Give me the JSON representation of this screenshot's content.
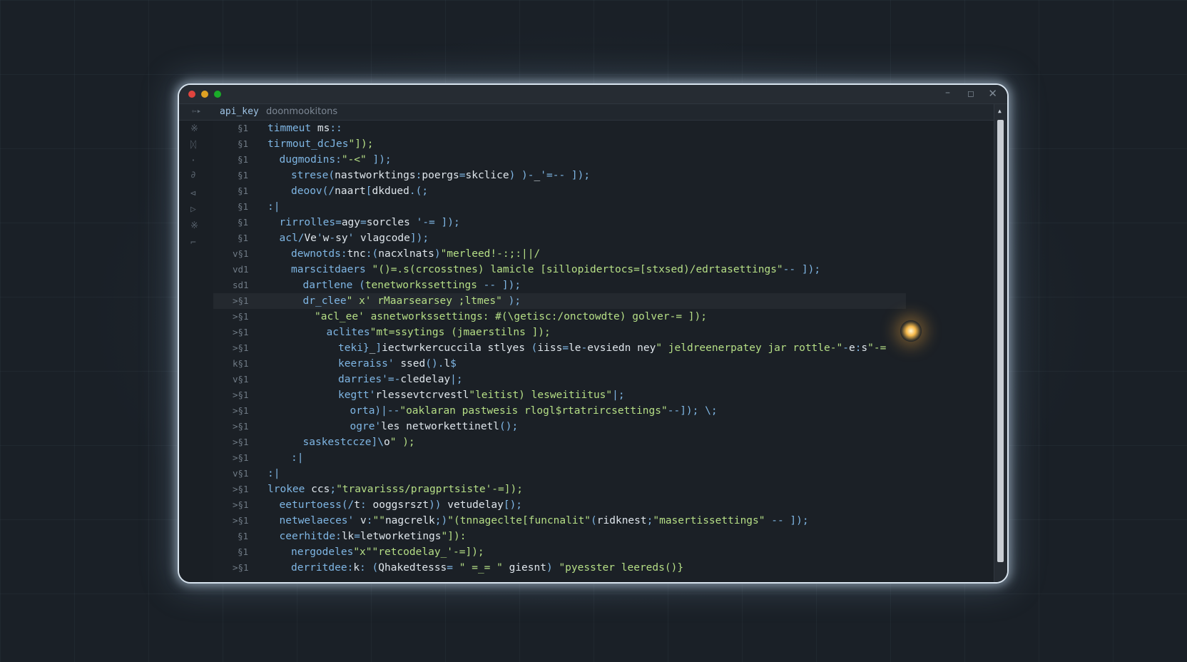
{
  "window": {
    "controls": {
      "minimize": "–",
      "maximize": "◻",
      "close": "✕"
    }
  },
  "tabbar": {
    "nav_glyph": "⇦▸",
    "tabs": [
      {
        "label": "api_key"
      },
      {
        "label": "doonmookitons"
      }
    ]
  },
  "activity_icons": [
    {
      "name": "search-icon",
      "glyph": "※"
    },
    {
      "name": "branch-icon",
      "glyph": "ᛞ"
    },
    {
      "name": "separator-icon",
      "glyph": "·"
    },
    {
      "name": "debug-icon",
      "glyph": "∂"
    },
    {
      "name": "extensions-icon",
      "glyph": "⊲"
    },
    {
      "name": "run-icon",
      "glyph": "▷"
    },
    {
      "name": "settings-icon",
      "glyph": "※"
    },
    {
      "name": "tool-icon",
      "glyph": "⌐"
    }
  ],
  "code_lines": [
    {
      "ln": "§1",
      "indent": 0,
      "text": "timmeut ms::"
    },
    {
      "ln": "§1",
      "indent": 0,
      "text": "tirmout_dcJes\"]);"
    },
    {
      "ln": "§1",
      "indent": 1,
      "text": "dugmodins:\"-<\" ]);"
    },
    {
      "ln": "§1",
      "indent": 2,
      "text": "strese(nastworktings:poergs=skclice) )-_'=-- ]);"
    },
    {
      "ln": "§1",
      "indent": 2,
      "text": "deoov(/naart[dkdued.(;"
    },
    {
      "ln": "§1",
      "indent": 0,
      "text": ":|"
    },
    {
      "ln": "§1",
      "indent": 1,
      "text": "rirrolles=agy=sorcles '-= ]);"
    },
    {
      "ln": "§1",
      "indent": 1,
      "text": "acl/Ve'w-sy' vlagcode]);"
    },
    {
      "ln": "v§1",
      "indent": 2,
      "text": "dewnotds:tnc:(nacxlnats)\"merleed!-:;:||/"
    },
    {
      "ln": "vd1",
      "indent": 2,
      "text": "marscitdaers \"()=.s(crcosstnes) lamicle [sillopidertocs=[stxsed)/edrtasettings\"-- ]);"
    },
    {
      "ln": "sd1",
      "indent": 3,
      "text": "dartlene (tenetworkssettings -- ]);"
    },
    {
      "ln": ">§1",
      "indent": 3,
      "text": "dr_clee\" x' rMaarsearsey ;ltmes\" );"
    },
    {
      "ln": ">§1",
      "indent": 4,
      "text": "\"acl_ee' asnetworkssettings: #(\\getisc:/onctowdte) golver-= ]);"
    },
    {
      "ln": ">§1",
      "indent": 5,
      "text": "aclites\"mt=ssytings (jmaerstilns ]);"
    },
    {
      "ln": ">§1",
      "indent": 6,
      "text": "teki}_]iectwrkercuccila stlyes (iiss=le-evsiedn ney\" jeldreenerpatey jar rottle-\"-e:s\"-="
    },
    {
      "ln": "k§1",
      "indent": 6,
      "text": "keeraiss' ssed().l$"
    },
    {
      "ln": "v§1",
      "indent": 6,
      "text": "darries'=-cledelay|;"
    },
    {
      "ln": ">§1",
      "indent": 6,
      "text": "kegtt'rlessevtcrvestl\"leitist) lesweitiitus\"|;"
    },
    {
      "ln": ">§1",
      "indent": 7,
      "text": "orta)|--\"oaklaran pastwesis rlogl$rtatrircsettings\"--]); \\;"
    },
    {
      "ln": ">§1",
      "indent": 7,
      "text": "ogre'les networkettinetl();"
    },
    {
      "ln": ">§1",
      "indent": 3,
      "text": "saskestccze]\\o\" );"
    },
    {
      "ln": ">§1",
      "indent": 2,
      "text": ":|"
    },
    {
      "ln": "v§1",
      "indent": 0,
      "text": ":|"
    },
    {
      "ln": ">§1",
      "indent": 0,
      "text": "lrokee ccs;\"travarisss/pragprtsiste'-=]);"
    },
    {
      "ln": ">§1",
      "indent": 1,
      "text": "eeturtoess(/t: ooggsrszt)) vetudelay[);"
    },
    {
      "ln": ">§1",
      "indent": 1,
      "text": "netwelaeces' v:\"\"nagcrelk;)\"(tnnageclte[funcnalit\"(ridknest;\"masertissettings\" -- ]);"
    },
    {
      "ln": "§1",
      "indent": 1,
      "text": "ceerhitde:lk=letworketings\"]):"
    },
    {
      "ln": "§1",
      "indent": 2,
      "text": "nergodeles\"x\"\"retcodelay_'-=]);"
    },
    {
      "ln": ">§1",
      "indent": 2,
      "text": "derritdee:k: (Qhakedtesss= \" =_= \" giesnt) \"pyesster leereds()}"
    }
  ]
}
